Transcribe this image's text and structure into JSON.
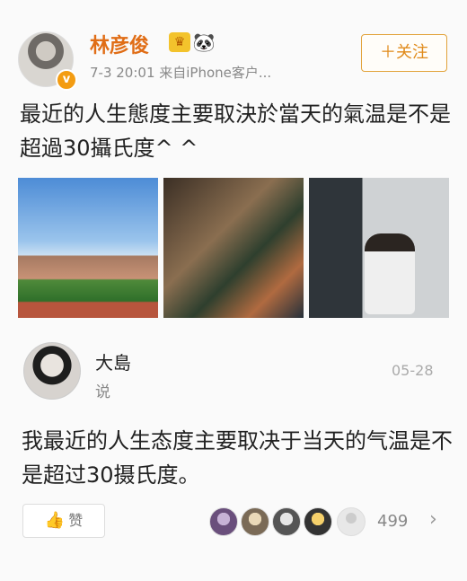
{
  "post": {
    "author": "林彦俊",
    "crown_icon": "crown-badge-icon",
    "panda_icon": "panda-emoji-icon",
    "meta": "7-3 20:01 来自iPhone客户...",
    "follow_label": "＋关注",
    "text": "最近的人生態度主要取決於當天的氣温是不是超過30攝氏度^ ^",
    "verified_badge": "v"
  },
  "comment": {
    "name": "大島",
    "sub": "说",
    "date": "05-28",
    "text": "我最近的人生态度主要取决于当天的气温是不是超过30摄氏度。"
  },
  "footer": {
    "like_label": "赞",
    "count": "499",
    "chevron": "›"
  },
  "colors": {
    "accent_orange": "#e06d16",
    "follow_border": "#e2a33b"
  }
}
